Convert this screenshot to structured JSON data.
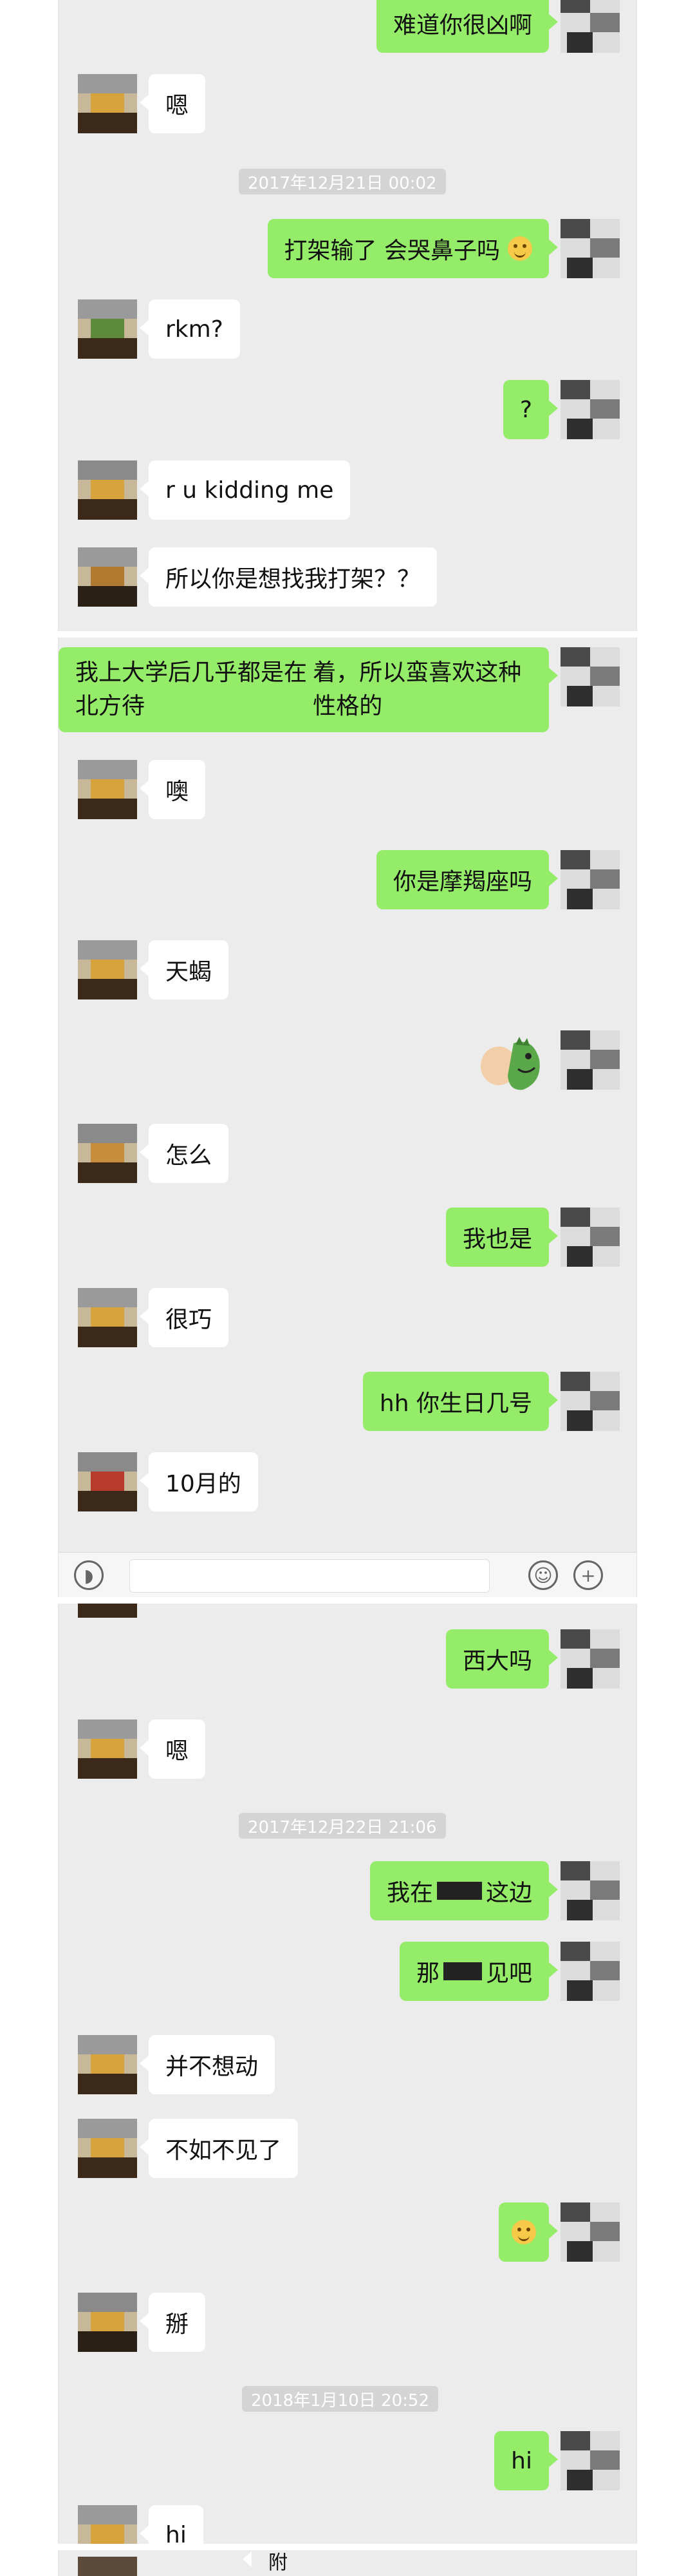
{
  "colors": {
    "bubble_out": "#95ec69",
    "bubble_in": "#ffffff",
    "chat_bg": "#ececec",
    "timestamp_bg": "#d4d4d4"
  },
  "panel1": {
    "m1": "难道你很凶啊",
    "m2": "嗯",
    "ts1": "2017年12月21日 00:02",
    "m3": "打架输了 会哭鼻子吗",
    "m4": "rkm?",
    "m5": "?",
    "m6": "r u kidding me",
    "m7": "所以你是想找我打架？？"
  },
  "panel2": {
    "m1_line1": "我上大学后几乎都是在北方待",
    "m1_line2": "着，所以蛮喜欢这种性格的",
    "m2": "噢",
    "m3": "你是摩羯座吗",
    "m4": "天蝎",
    "m5_sticker": "dinosaur-sticker",
    "m6": "怎么",
    "m7": "我也是",
    "m8": "很巧",
    "m9": "hh 你生日几号",
    "m10": "10月的"
  },
  "panel3": {
    "m1": "西大吗",
    "m2": "嗯",
    "ts1": "2017年12月22日 21:06",
    "m3_a": "我在",
    "m3_b": "这边",
    "m4_a": "那",
    "m4_b": "见吧",
    "m5": "并不想动",
    "m6": "不如不见了",
    "m7_emoji": "smile-emoji",
    "m8": "掰",
    "ts2": "2018年1月10日 20:52",
    "m9": "hi",
    "m10": "hi"
  },
  "panel4": {
    "partial": "附"
  }
}
